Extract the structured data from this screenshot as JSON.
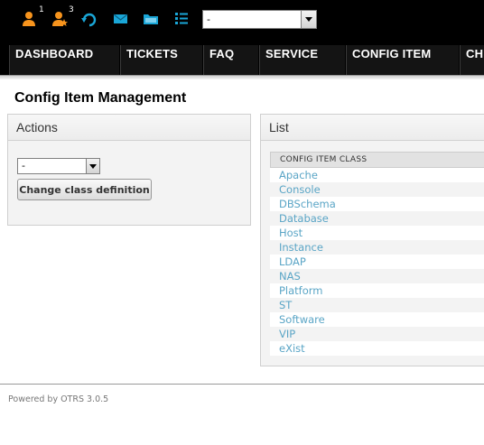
{
  "toolbar": {
    "icons": [
      {
        "name": "locked-tickets-icon",
        "badge": "1",
        "color": "#f7941d"
      },
      {
        "name": "watched-tickets-icon",
        "badge": "3",
        "color": "#f7941d"
      },
      {
        "name": "refresh-icon",
        "color": "#1aa6d7"
      },
      {
        "name": "mail-icon",
        "color": "#1aa6d7"
      },
      {
        "name": "folder-icon",
        "color": "#1aa6d7"
      },
      {
        "name": "list-icon",
        "color": "#1aa6d7"
      }
    ],
    "queue_select_value": "-"
  },
  "nav": {
    "items": [
      "DASHBOARD",
      "TICKETS",
      "FAQ",
      "SERVICE",
      "CONFIG ITEM",
      "CH"
    ]
  },
  "page": {
    "title": "Config Item Management"
  },
  "actions": {
    "title": "Actions",
    "class_select_value": "-",
    "change_button_label": "Change class definition"
  },
  "list": {
    "title": "List",
    "column_header": "CONFIG ITEM CLASS",
    "rows": [
      "Apache",
      "Console",
      "DBSchema",
      "Database",
      "Host",
      "Instance",
      "LDAP",
      "NAS",
      "Platform",
      "ST",
      "Software",
      "VIP",
      "eXist"
    ]
  },
  "footer": {
    "text": "Powered by OTRS 3.0.5"
  },
  "colors": {
    "accent_orange": "#f7941d",
    "accent_blue": "#1aa6d7",
    "link": "#5aa5c6"
  }
}
